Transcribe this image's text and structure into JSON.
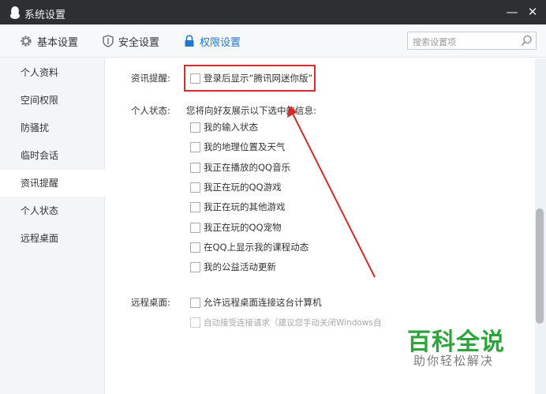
{
  "window": {
    "title": "系统设置",
    "minimize": "—",
    "close": "✕"
  },
  "toolbar": {
    "tabs": [
      {
        "label": "基本设置",
        "icon": "gear-icon"
      },
      {
        "label": "安全设置",
        "icon": "shield-icon"
      },
      {
        "label": "权限设置",
        "icon": "lock-icon",
        "active": true
      }
    ],
    "search_placeholder": "搜索设置项"
  },
  "sidebar": {
    "items": [
      {
        "label": "个人资料"
      },
      {
        "label": "空间权限"
      },
      {
        "label": "防骚扰"
      },
      {
        "label": "临时会话"
      },
      {
        "label": "资讯提醒",
        "active": true
      },
      {
        "label": "个人状态"
      },
      {
        "label": "远程桌面"
      }
    ]
  },
  "sections": {
    "news": {
      "label": "资讯提醒:",
      "option": "登录后显示“腾讯网迷你版”"
    },
    "status": {
      "label": "个人状态:",
      "description": "您将向好友展示以下选中的信息:",
      "options": [
        "我的输入状态",
        "我的地理位置及天气",
        "我正在播放的QQ音乐",
        "我正在玩的QQ游戏",
        "我正在玩的其他游戏",
        "我正在玩的QQ宠物",
        "在QQ上显示我的课程动态",
        "我的公益活动更新"
      ]
    },
    "remote": {
      "label": "远程桌面:",
      "option_allow": "允许远程桌面连接这台计算机",
      "option_auto": "自动接受连接请求（建议您手动关闭Windows自"
    }
  },
  "watermark": {
    "main": "百科全说",
    "sub": "助你轻松解决"
  },
  "colors": {
    "titlebar": "#2e2f33",
    "accent": "#2277d1",
    "highlight": "#d92a2a",
    "watermark": "#2ca53a"
  }
}
